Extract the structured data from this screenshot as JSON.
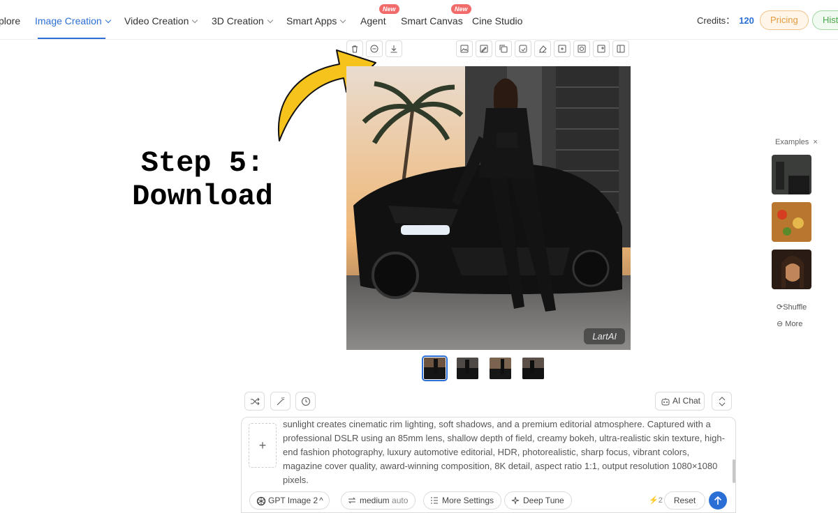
{
  "nav": {
    "items": [
      "plore",
      "Image Creation",
      "Video Creation",
      "3D Creation",
      "Smart Apps",
      "Agent",
      "Smart Canvas",
      "Cine Studio"
    ],
    "new_badge": "New",
    "credits_label": "Credits：",
    "credits_value": "120",
    "pricing": "Pricing",
    "history": "Hist"
  },
  "toolbar": {
    "left_icons": [
      "trash-icon",
      "minus-circle-icon",
      "download-icon"
    ],
    "right_icons": [
      "image-icon",
      "image-edit-icon",
      "copy-icon",
      "redraw-icon",
      "eraser-icon",
      "expand-image-icon",
      "upscale-icon",
      "add-image-icon",
      "split-view-icon"
    ]
  },
  "annotation": {
    "line1": "Step 5:",
    "line2": "Download",
    "arrow_color": "#f6c21c"
  },
  "image": {
    "watermark": "LartAI"
  },
  "examples": {
    "title": "Examples",
    "close": "×",
    "shuffle": "Shuffle",
    "more": "More"
  },
  "prompt": {
    "ai_chat": "AI Chat",
    "upload": "+",
    "text": "sunlight creates cinematic rim lighting, soft shadows, and a premium editorial atmosphere. Captured with a professional DSLR using an 85mm lens, shallow depth of field, creamy bokeh, ultra-realistic skin texture, high-end fashion photography, luxury automotive editorial, HDR, photorealistic, sharp focus, vibrant colors, magazine cover quality, award-winning composition, 8K detail, aspect ratio 1:1, output resolution 1080×1080 pixels.",
    "model": "GPT Image 2",
    "quality": "medium",
    "quality_mode": "auto",
    "more_settings": "More Settings",
    "deep_tune": "Deep Tune",
    "cost": "2",
    "reset": "Reset"
  },
  "colors": {
    "accent": "#2b6fd6",
    "badge": "#f26b6b"
  }
}
